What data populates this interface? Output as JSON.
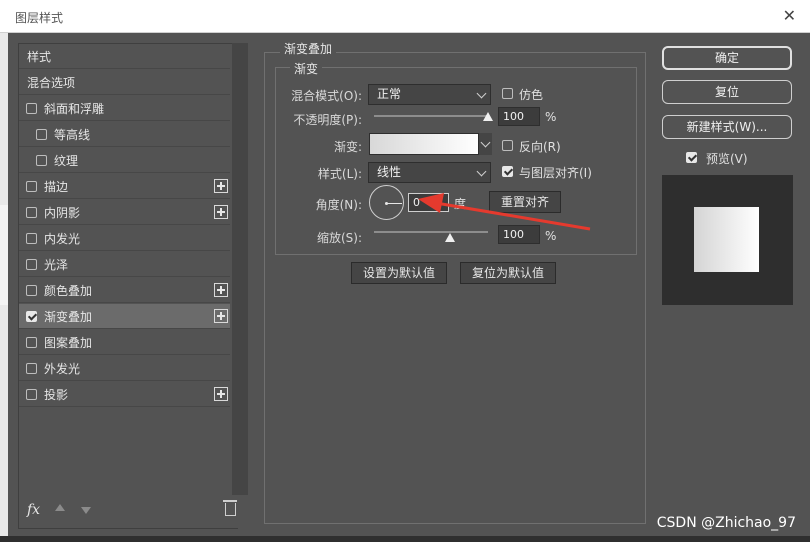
{
  "window": {
    "title": "图层样式",
    "close": "✕"
  },
  "styles_list": {
    "items": [
      {
        "label": "样式",
        "checkbox": false,
        "checked": false,
        "plus": false
      },
      {
        "label": "混合选项",
        "checkbox": false,
        "checked": false,
        "plus": false
      },
      {
        "label": "斜面和浮雕",
        "checkbox": true,
        "checked": false,
        "plus": false
      },
      {
        "label": "等高线",
        "checkbox": true,
        "checked": false,
        "plus": false,
        "indent": true
      },
      {
        "label": "纹理",
        "checkbox": true,
        "checked": false,
        "plus": false,
        "indent": true
      },
      {
        "label": "描边",
        "checkbox": true,
        "checked": false,
        "plus": true
      },
      {
        "label": "内阴影",
        "checkbox": true,
        "checked": false,
        "plus": true
      },
      {
        "label": "内发光",
        "checkbox": true,
        "checked": false,
        "plus": false
      },
      {
        "label": "光泽",
        "checkbox": true,
        "checked": false,
        "plus": false
      },
      {
        "label": "颜色叠加",
        "checkbox": true,
        "checked": false,
        "plus": true
      },
      {
        "label": "渐变叠加",
        "checkbox": true,
        "checked": true,
        "plus": true,
        "selected": true
      },
      {
        "label": "图案叠加",
        "checkbox": true,
        "checked": false,
        "plus": false
      },
      {
        "label": "外发光",
        "checkbox": true,
        "checked": false,
        "plus": false
      },
      {
        "label": "投影",
        "checkbox": true,
        "checked": false,
        "plus": true
      }
    ],
    "fx_label": "fx"
  },
  "panel": {
    "group_title": "渐变叠加",
    "subgroup_title": "渐变",
    "blend_mode_label": "混合模式(O):",
    "blend_mode_value": "正常",
    "dither_label": "仿色",
    "opacity_label": "不透明度(P):",
    "opacity_value": "100",
    "opacity_unit": "%",
    "opacity_level": 1.0,
    "gradient_label": "渐变:",
    "reverse_label": "反向(R)",
    "style_label": "样式(L):",
    "style_value": "线性",
    "align_label": "与图层对齐(I)",
    "angle_label": "角度(N):",
    "angle_value": "0",
    "angle_unit": "度",
    "reset_align_label": "重置对齐",
    "scale_label": "缩放(S):",
    "scale_value": "100",
    "scale_unit": "%",
    "set_default_label": "设置为默认值",
    "reset_default_label": "复位为默认值"
  },
  "right": {
    "ok_label": "确定",
    "reset_label": "复位",
    "new_style_label": "新建样式(W)...",
    "preview_label": "预览(V)"
  },
  "watermark": "CSDN @Zhichao_97",
  "colors": {
    "dialog_bg": "#535353",
    "annotation_arrow": "#e53a2e"
  }
}
